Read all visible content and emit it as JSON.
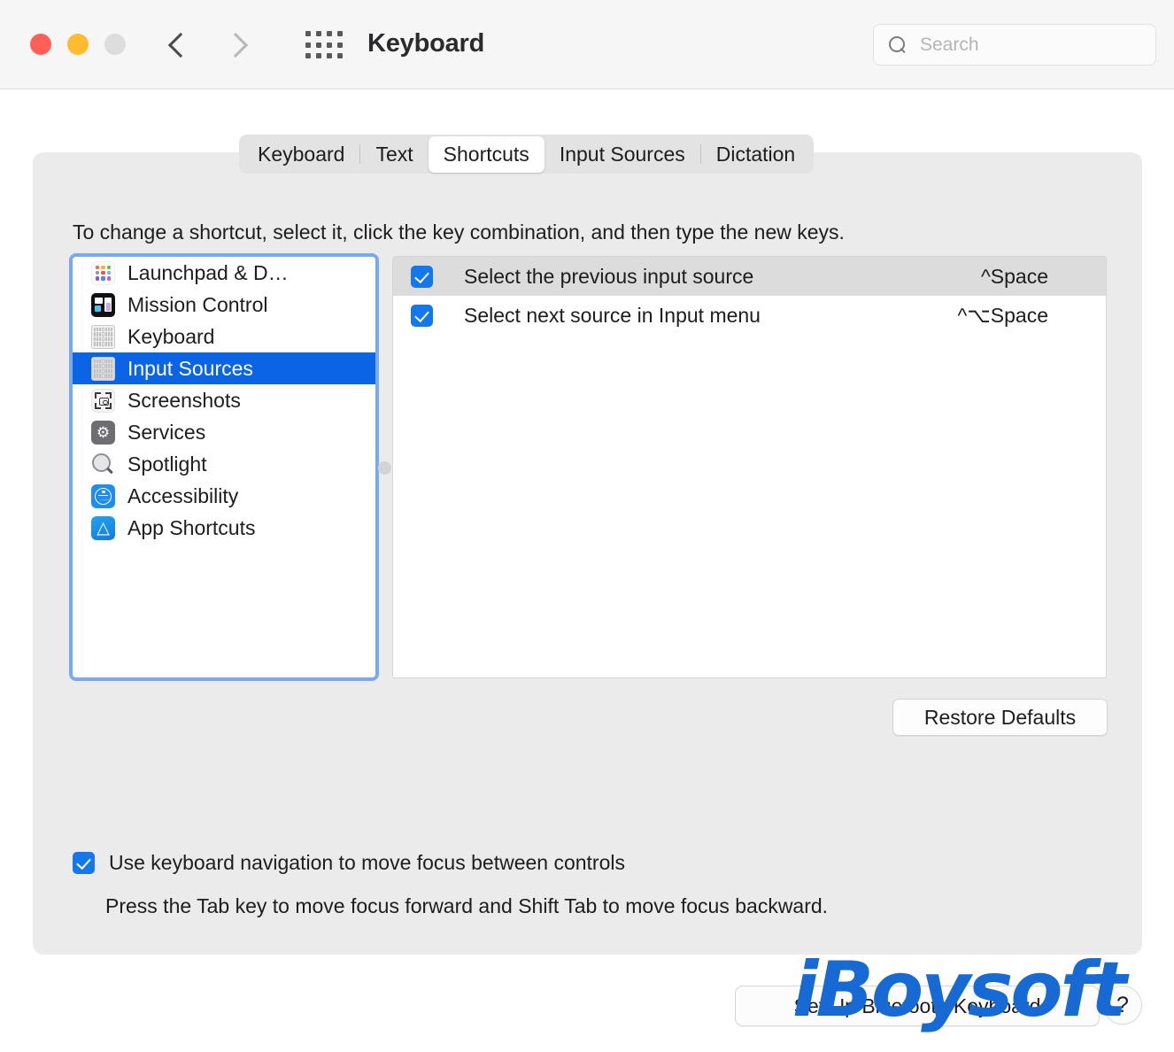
{
  "window": {
    "title": "Keyboard",
    "traffic_lights": [
      "close",
      "minimize",
      "zoom"
    ],
    "nav": {
      "back": "back-arrow",
      "forward": "forward-arrow"
    },
    "grid_button": "show-all-icon"
  },
  "search": {
    "placeholder": "Search",
    "value": "",
    "icon": "search-icon"
  },
  "tabs": [
    {
      "label": "Keyboard",
      "selected": false
    },
    {
      "label": "Text",
      "selected": false
    },
    {
      "label": "Shortcuts",
      "selected": true
    },
    {
      "label": "Input Sources",
      "selected": false
    },
    {
      "label": "Dictation",
      "selected": false
    }
  ],
  "instruction": "To change a shortcut, select it, click the key combination, and then type the new keys.",
  "sidebar": {
    "items": [
      {
        "label": "Launchpad & D…",
        "icon": "launchpad-icon",
        "selected": false
      },
      {
        "label": "Mission Control",
        "icon": "mission-control-icon",
        "selected": false
      },
      {
        "label": "Keyboard",
        "icon": "keyboard-icon",
        "selected": false
      },
      {
        "label": "Input Sources",
        "icon": "input-sources-icon",
        "selected": true
      },
      {
        "label": "Screenshots",
        "icon": "screenshots-icon",
        "selected": false
      },
      {
        "label": "Services",
        "icon": "services-gear-icon",
        "selected": false
      },
      {
        "label": "Spotlight",
        "icon": "spotlight-icon",
        "selected": false
      },
      {
        "label": "Accessibility",
        "icon": "accessibility-icon",
        "selected": false
      },
      {
        "label": "App Shortcuts",
        "icon": "app-store-icon",
        "selected": false
      }
    ]
  },
  "shortcuts": {
    "rows": [
      {
        "name": "Select the previous input source",
        "keys": "^Space",
        "checked": true,
        "highlighted": true
      },
      {
        "name": "Select next source in Input menu",
        "keys": "^⌥Space",
        "checked": true,
        "highlighted": false
      }
    ]
  },
  "buttons": {
    "restore_defaults": "Restore Defaults",
    "setup_bluetooth_keyboard": "Set Up Bluetooth Keyboard",
    "help": "?"
  },
  "keyboard_navigation": {
    "label": "Use keyboard navigation to move focus between controls",
    "checked": true,
    "hint": "Press the Tab key to move focus forward and Shift Tab to move focus backward."
  },
  "watermark": {
    "text": "iBoysoft",
    "color": "#1769d3"
  },
  "colors": {
    "accent_blue": "#0a64e4",
    "checkbox_blue": "#1478ec",
    "focus_ring": "#7aaaee",
    "row_highlight": "#dcdcdd",
    "panel_bg": "#ebebec"
  }
}
